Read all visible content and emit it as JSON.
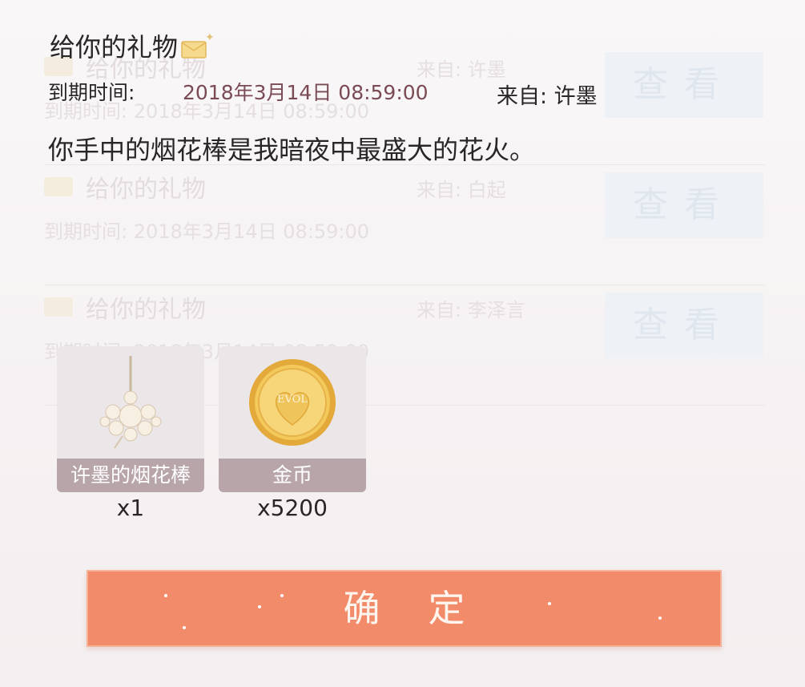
{
  "dialog": {
    "title": "给你的礼物",
    "expiry_label": "到期时间:",
    "expiry_value": "2018年3月14日 08:59:00",
    "from_label": "来自: 许墨",
    "message": "你手中的烟花棒是我暗夜中最盛大的花火。",
    "items": [
      {
        "name": "许墨的烟花棒",
        "qty": "x1",
        "icon": "sparkler-icon"
      },
      {
        "name": "金币",
        "qty": "x5200",
        "icon": "gold-coin-icon",
        "coin_text": "EVOL"
      }
    ],
    "confirm_label": "确定"
  },
  "background_list": [
    {
      "title": "给你的礼物",
      "from": "来自: 许墨",
      "expiry": "到期时间: 2018年3月14日 08:59:00",
      "view_label": "查看"
    },
    {
      "title": "给你的礼物",
      "from": "来自: 白起",
      "expiry": "到期时间: 2018年3月14日 08:59:00",
      "view_label": "查看"
    },
    {
      "title": "给你的礼物",
      "from": "来自: 李泽言",
      "expiry": "到期时间: 2018年3月14日 08:59:00",
      "view_label": "查看"
    }
  ],
  "colors": {
    "confirm": "#f28b6a",
    "caption": "#b8a5aa",
    "coin": "#e8b84a",
    "expiry": "#7a4a55"
  }
}
